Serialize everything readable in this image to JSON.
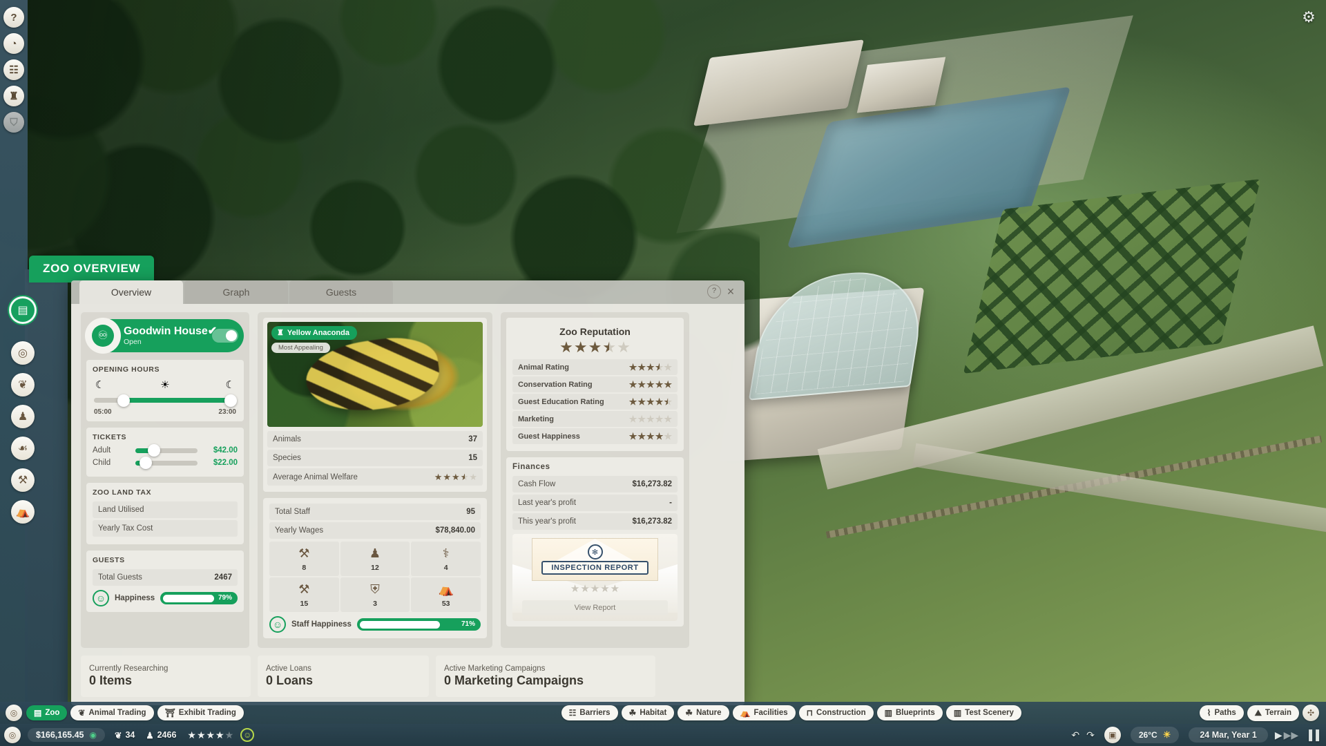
{
  "scene": {
    "name": "planet-zoo-isometric-park-view"
  },
  "top_rail": {
    "icons": [
      {
        "name": "help-icon",
        "glyph": "?"
      },
      {
        "name": "zoopedia-icon",
        "glyph": "◔"
      },
      {
        "name": "calendar-icon",
        "glyph": "☷"
      },
      {
        "name": "trophy-icon",
        "glyph": "♜"
      },
      {
        "name": "locked-icon",
        "glyph": "⛉"
      }
    ],
    "settings_icon": "⚙"
  },
  "side_dock": {
    "icons": [
      {
        "name": "zoo-overview-icon",
        "glyph": "ὌB",
        "fallback": "▤",
        "active": true
      },
      {
        "name": "animals-manage-icon",
        "glyph": "◎",
        "active": false
      },
      {
        "name": "animals-paw-icon",
        "glyph": "❦",
        "active": false
      },
      {
        "name": "staff-icon",
        "glyph": "♟",
        "active": false
      },
      {
        "name": "keeper-icon",
        "glyph": "☙",
        "active": false
      },
      {
        "name": "mechanic-icon",
        "glyph": "⚒",
        "active": false
      },
      {
        "name": "shops-icon",
        "glyph": "⛺",
        "active": false
      }
    ]
  },
  "panel_title": "ZOO OVERVIEW",
  "window": {
    "tabs": [
      {
        "label": "Overview",
        "active": true
      },
      {
        "label": "Graph",
        "active": false
      },
      {
        "label": "Guests",
        "active": false
      }
    ],
    "help_glyph": "?",
    "close_glyph": "×"
  },
  "zoo": {
    "name": "Goodwin House",
    "name_suffix": "✔",
    "status": "Open",
    "logo_glyph": "♾",
    "toggle_on": true
  },
  "opening_hours": {
    "title": "OPENING HOURS",
    "moon_icon": "☾",
    "sun_icon": "☀",
    "open_time": "05:00",
    "close_time": "23:00",
    "open_pct": 21,
    "close_pct": 96
  },
  "tickets": {
    "title": "TICKETS",
    "rows": [
      {
        "label": "Adult",
        "price": "$42.00",
        "pct": 30
      },
      {
        "label": "Child",
        "price": "$22.00",
        "pct": 17
      }
    ]
  },
  "land_tax": {
    "title": "ZOO LAND TAX",
    "rows": [
      {
        "label": "Land Utilised",
        "value": ""
      },
      {
        "label": "Yearly Tax Cost",
        "value": ""
      }
    ]
  },
  "guests": {
    "title": "GUESTS",
    "total_label": "Total Guests",
    "total_value": "2467",
    "happiness_label": "Happiness",
    "happiness_pct": "79%",
    "happiness_value": 79,
    "smiley_glyph": "☺"
  },
  "featured_animal": {
    "name": "Yellow Anaconda",
    "badge_icon": "♜",
    "subtitle": "Most Appealing"
  },
  "animal_stats": {
    "rows": [
      {
        "label": "Animals",
        "value": "37"
      },
      {
        "label": "Species",
        "value": "15"
      }
    ],
    "welfare_label": "Average Animal Welfare",
    "welfare_stars": 3.5
  },
  "staff": {
    "total_label": "Total Staff",
    "total_value": "95",
    "wages_label": "Yearly Wages",
    "wages_value": "$78,840.00",
    "cells": [
      {
        "name": "mechanic-icon",
        "glyph": "⚒",
        "count": "8"
      },
      {
        "name": "keeper-icon",
        "glyph": "♟",
        "count": "12"
      },
      {
        "name": "vet-icon",
        "glyph": "⚕",
        "count": "4"
      },
      {
        "name": "caretaker-icon",
        "glyph": "⚒",
        "count": "15"
      },
      {
        "name": "security-icon",
        "glyph": "⛨",
        "count": "3"
      },
      {
        "name": "vendor-icon",
        "glyph": "⛺",
        "count": "53"
      }
    ],
    "happiness_label": "Staff Happiness",
    "happiness_pct": "71%",
    "happiness_value": 71,
    "smiley_glyph": "☺"
  },
  "reputation": {
    "title": "Zoo Reputation",
    "overall_stars": 3.5,
    "rows": [
      {
        "label": "Animal Rating",
        "stars": 3.5
      },
      {
        "label": "Conservation Rating",
        "stars": 5
      },
      {
        "label": "Guest Education Rating",
        "stars": 4.5
      },
      {
        "label": "Marketing",
        "stars": 0
      },
      {
        "label": "Guest Happiness",
        "stars": 4
      }
    ]
  },
  "finances": {
    "title": "Finances",
    "rows": [
      {
        "label": "Cash Flow",
        "value": "$16,273.82"
      },
      {
        "label": "Last year's profit",
        "value": "-"
      },
      {
        "label": "This year's profit",
        "value": "$16,273.82"
      }
    ]
  },
  "inspection": {
    "seal_glyph": "✻",
    "title": "INSPECTION REPORT",
    "stars": 0,
    "button": "View Report"
  },
  "summary_cards": [
    {
      "label": "Currently Researching",
      "value": "0 Items"
    },
    {
      "label": "Active Loans",
      "value": "0 Loans"
    },
    {
      "label": "Active Marketing Campaigns",
      "value": "0 Marketing Campaigns"
    }
  ],
  "taskbar_top": {
    "left_pills": [
      {
        "label": "Zoo",
        "icon": "▤",
        "active": true
      },
      {
        "label": "Animal Trading",
        "icon": "❦",
        "active": false
      },
      {
        "label": "Exhibit Trading",
        "icon": "⛩",
        "active": false
      }
    ],
    "center_pills": [
      {
        "label": "Barriers",
        "icon": "☷"
      },
      {
        "label": "Habitat",
        "icon": "☘"
      },
      {
        "label": "Nature",
        "icon": "☘"
      },
      {
        "label": "Facilities",
        "icon": "⛺"
      },
      {
        "label": "Construction",
        "icon": "⊓"
      },
      {
        "label": "Blueprints",
        "icon": "▥"
      },
      {
        "label": "Test Scenery",
        "icon": "▥"
      }
    ],
    "right_pills": [
      {
        "label": "Paths",
        "icon": "⌇"
      },
      {
        "label": "Terrain",
        "icon": "⛰"
      }
    ],
    "right_round_icon": "✣"
  },
  "taskbar_bottom": {
    "left_round_icon": "◎",
    "money": "$166,165.45",
    "money_icon": "◉",
    "animals_count": "34",
    "animals_icon": "❦",
    "guests_count": "2466",
    "guests_icon": "♟",
    "rating_stars": 3.5,
    "mood_glyph": "☺",
    "undo_icon": "↶",
    "redo_icon": "↷",
    "camera_icon": "▣",
    "temperature": "26°C",
    "weather_icon": "☀",
    "date": "24 Mar, Year 1",
    "play_icon": "▶",
    "fastforward_icon": "▶▶",
    "pause_icon": "▐▐"
  }
}
